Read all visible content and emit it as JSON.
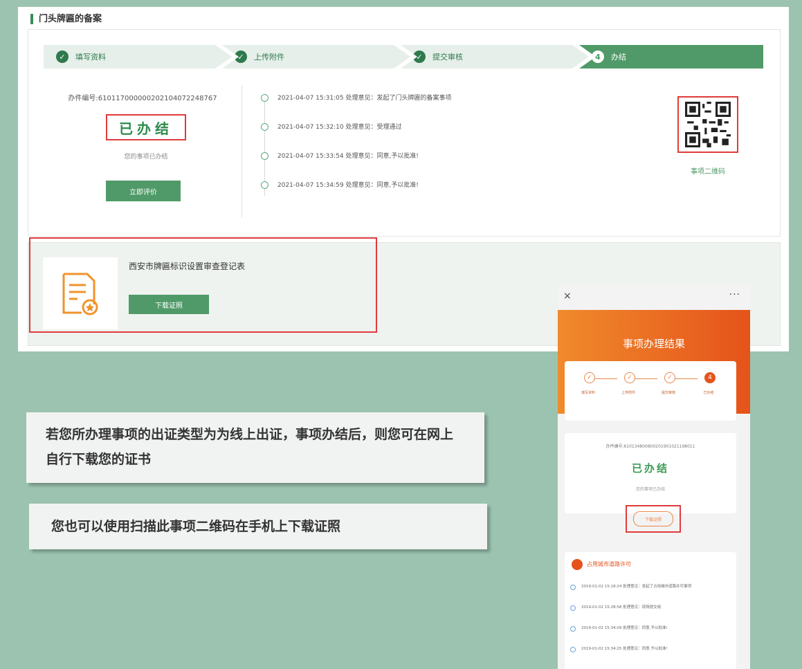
{
  "panel": {
    "title": "门头牌匾的备案",
    "steps": [
      {
        "label": "填写资料",
        "state": "done"
      },
      {
        "label": "上传附件",
        "state": "done"
      },
      {
        "label": "提交审核",
        "state": "done"
      },
      {
        "label": "办结",
        "state": "active",
        "number": "4"
      }
    ],
    "case_no": "办件编号:610117000000202104072248767",
    "status": "已办结",
    "status_sub": "您的事项已办结",
    "rate_button": "立即评价",
    "timeline": [
      "2021-04-07 15:31:05 处理意见：发起了门头牌匾的备案事项",
      "2021-04-07 15:32:10 处理意见：受理通过",
      "2021-04-07 15:33:54 处理意见：同意,予以批准!",
      "2021-04-07 15:34:59 处理意见：同意,予以批准!"
    ],
    "qr_label": "事项二维码",
    "certificate_name": "西安市牌匾标识设置审查登记表",
    "download_button": "下载证照",
    "check_icon": "check-icon",
    "cert_icon": "certificate-document-icon"
  },
  "notes": {
    "note1": "若您所办理事项的出证类型为为线上出证，事项办结后，则您可在网上自行下载您的证书",
    "note2": "您也可以使用扫描此事项二维码在手机上下载证照"
  },
  "phone": {
    "close": "×",
    "more": "···",
    "title": "事项办理结果",
    "steps": [
      "填写资料",
      "上传附件",
      "提交审核",
      "已办结"
    ],
    "step4_number": "4",
    "case_no": "办件编号:610134800800201901021198011",
    "status": "已办结",
    "status_sub": "您的事项已办结",
    "download_button": "下载证照",
    "section_title": "占用城市道路许可",
    "timeline": [
      "2019-01-02 15:18:24 处理意见：发起了占用城市道路许可事项",
      "2019-01-02 15:28:58 处理意见：现场提交成",
      "2019-01-02 15:34:09 处理意见：同意,予以批准!",
      "2019-01-02 15:34:25 处理意见：同意,予以批准!"
    ]
  },
  "colors": {
    "accent_green": "#4f9a68",
    "highlight_red": "#e03a3a",
    "phone_orange": "#e5531a",
    "background": "#9cc3b0"
  }
}
